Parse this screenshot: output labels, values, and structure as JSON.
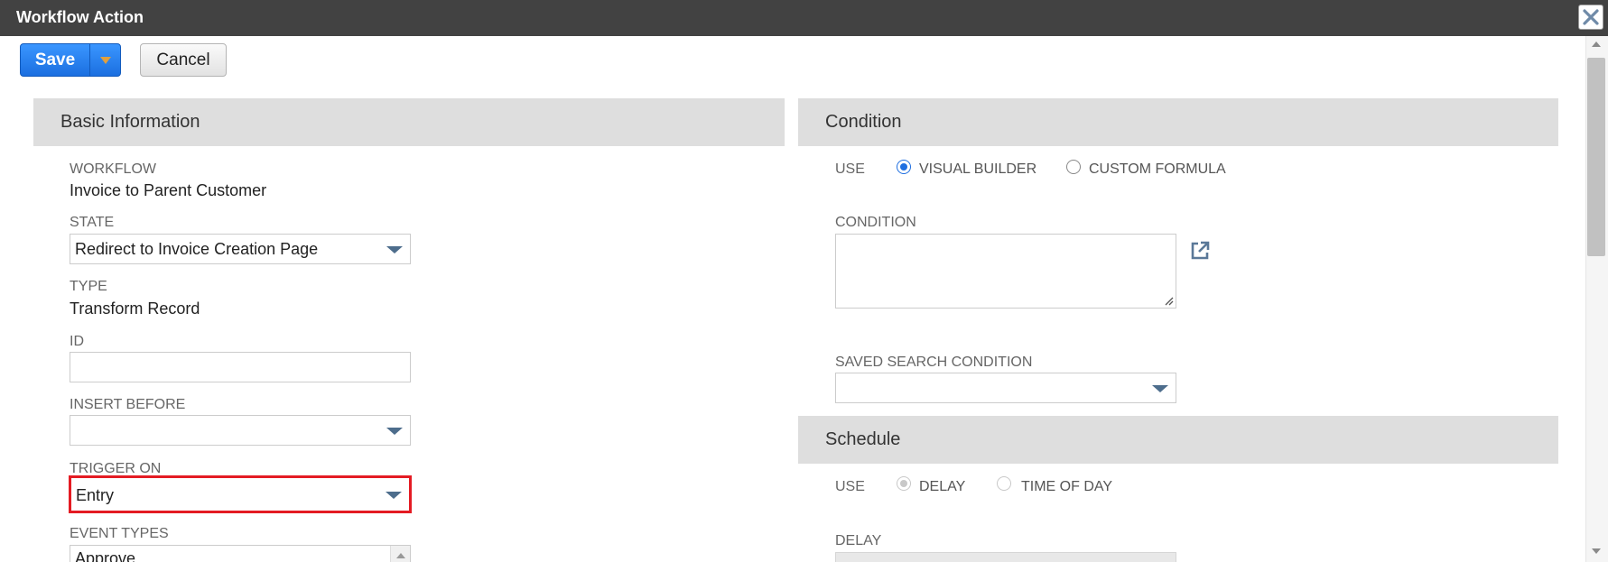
{
  "window": {
    "title": "Workflow Action"
  },
  "toolbar": {
    "save_label": "Save",
    "cancel_label": "Cancel"
  },
  "basic_information": {
    "header": "Basic Information",
    "workflow_label": "WORKFLOW",
    "workflow_value": "Invoice to Parent Customer",
    "state_label": "STATE",
    "state_value": "Redirect to Invoice Creation Page",
    "type_label": "TYPE",
    "type_value": "Transform Record",
    "id_label": "ID",
    "id_value": "",
    "insert_before_label": "INSERT BEFORE",
    "insert_before_value": "",
    "trigger_on_label": "TRIGGER ON",
    "trigger_on_value": "Entry",
    "event_types_label": "EVENT TYPES",
    "event_types_first_item": "Approve"
  },
  "condition": {
    "header": "Condition",
    "use_label": "USE",
    "option_visual_builder": "VISUAL BUILDER",
    "option_custom_formula": "CUSTOM FORMULA",
    "selected": "VISUAL BUILDER",
    "condition_label": "CONDITION",
    "condition_value": "",
    "saved_search_label": "SAVED SEARCH CONDITION",
    "saved_search_value": ""
  },
  "schedule": {
    "header": "Schedule",
    "use_label": "USE",
    "option_delay": "DELAY",
    "option_time_of_day": "TIME OF DAY",
    "selected": "DELAY",
    "delay_label": "DELAY"
  },
  "colors": {
    "titlebar": "#424242",
    "primary_button": "#1b6fe0",
    "section_header": "#dedede",
    "highlight": "#e41b23",
    "dropdown_arrow": "#4d6d8c"
  },
  "icons": [
    "close-icon",
    "chevron-down-icon",
    "open-external-icon",
    "resize-grip-icon"
  ]
}
